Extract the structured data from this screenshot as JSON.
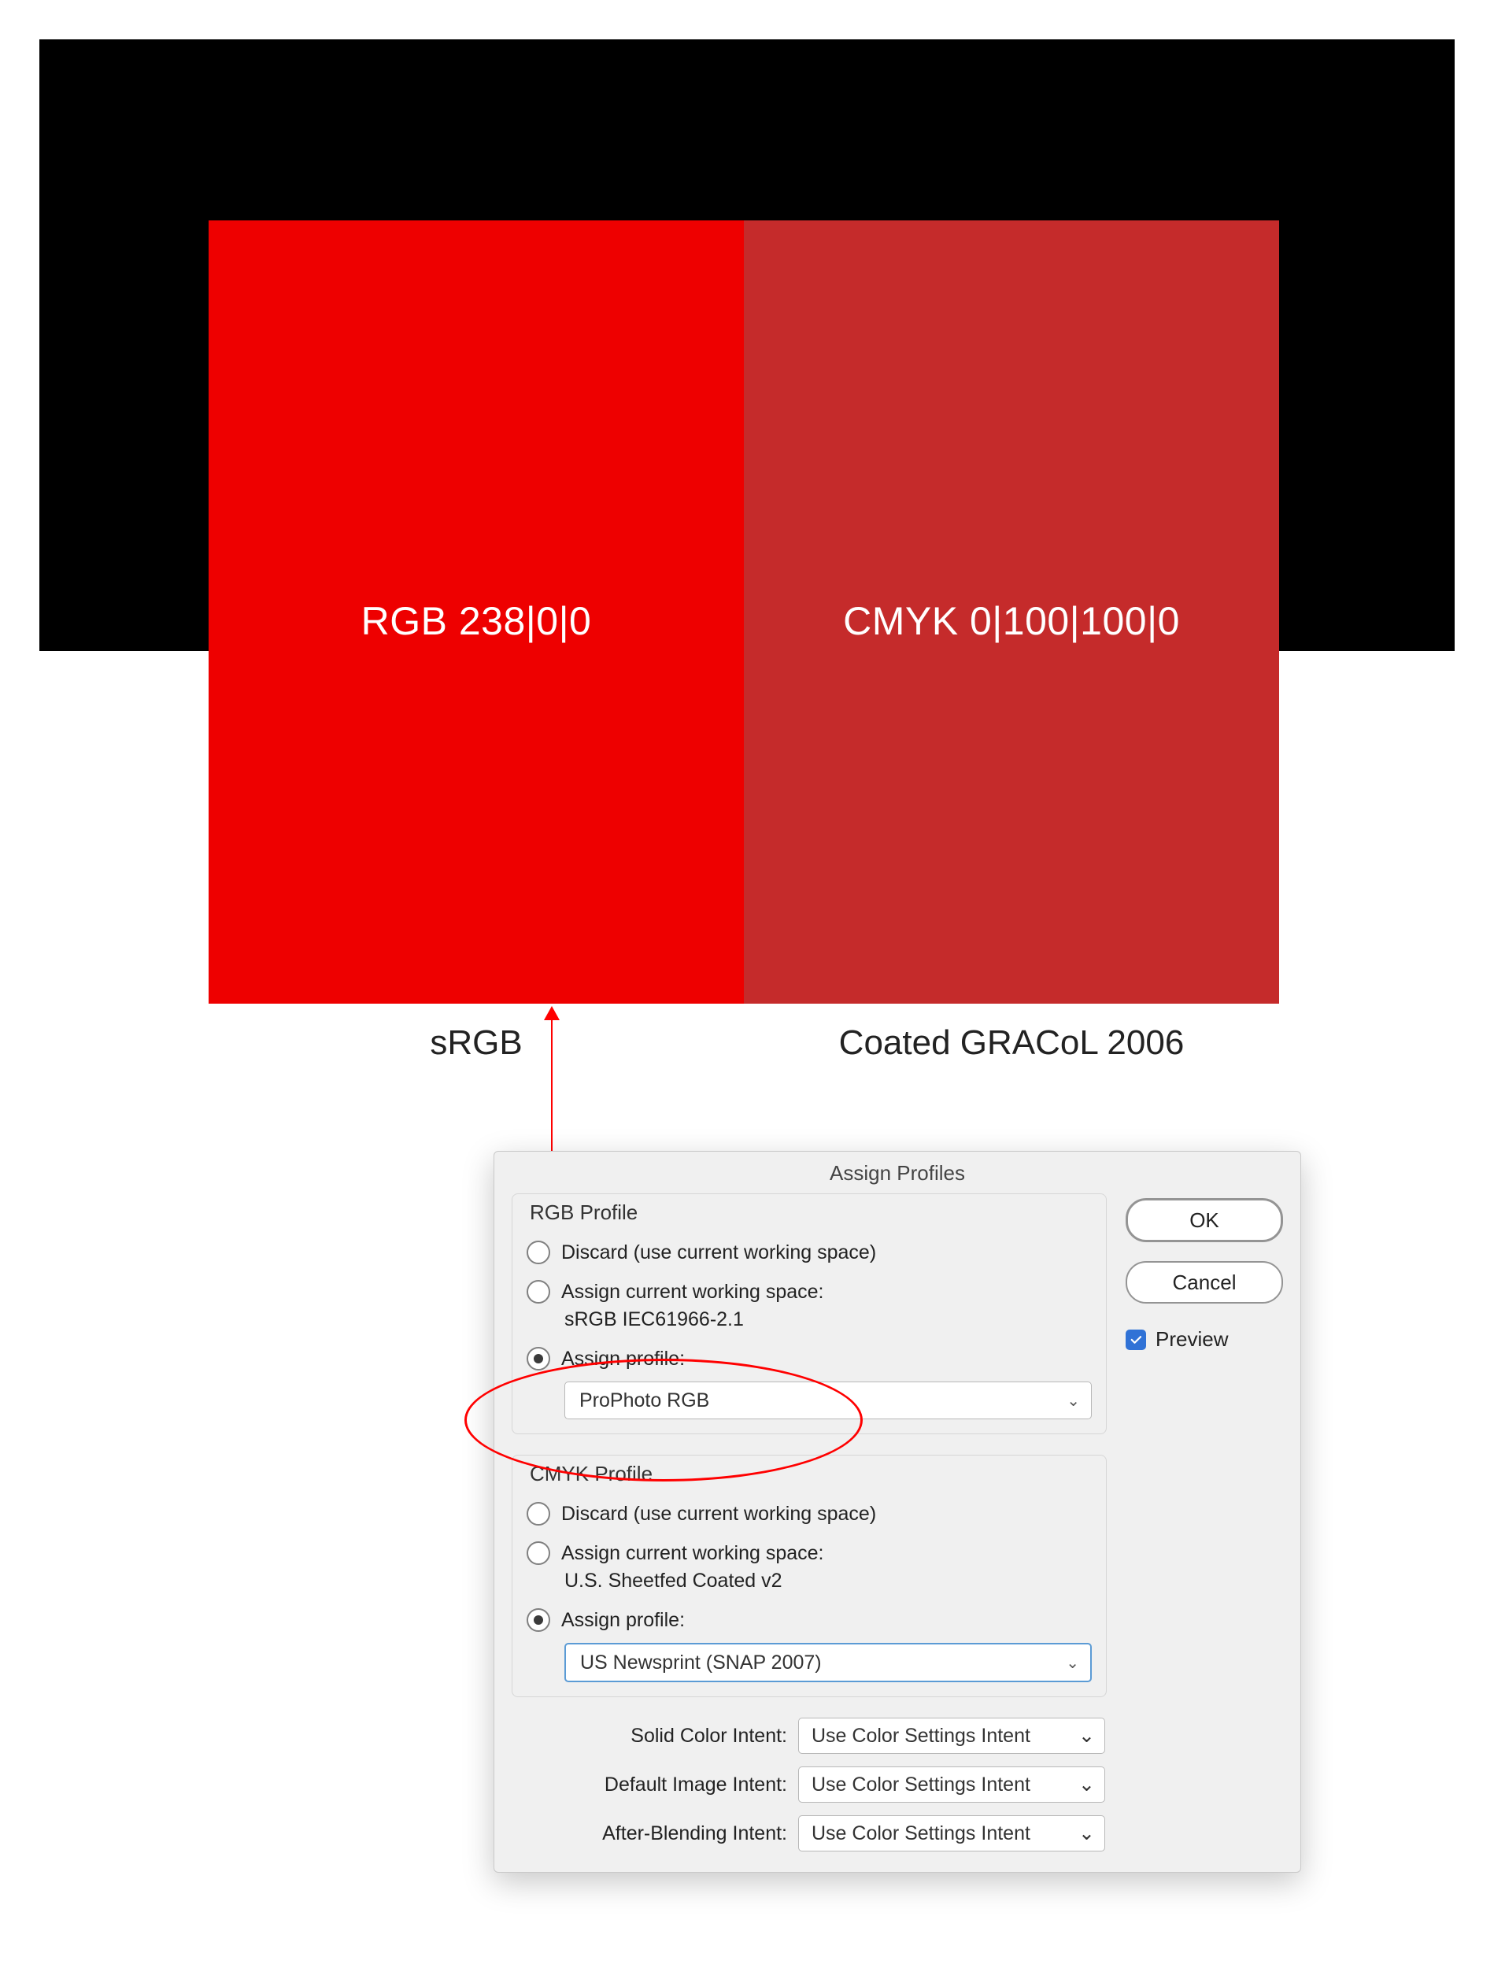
{
  "swatches": {
    "rgb_label": "RGB 238|0|0",
    "cmyk_label": "CMYK 0|100|100|0",
    "rgb_color": "#ee0000",
    "cmyk_color": "#c52b2b"
  },
  "captions": {
    "left": "sRGB",
    "right": "Coated GRACoL 2006"
  },
  "dialog": {
    "title": "Assign Profiles",
    "rgb": {
      "section_title": "RGB Profile",
      "discard": "Discard (use current working space)",
      "assign_current": "Assign current working space:",
      "current_value": "sRGB IEC61966-2.1",
      "assign_profile": "Assign profile:",
      "profile_value": "ProPhoto RGB"
    },
    "cmyk": {
      "section_title": "CMYK Profile",
      "discard": "Discard (use current working space)",
      "assign_current": "Assign current working space:",
      "current_value": "U.S. Sheetfed Coated v2",
      "assign_profile": "Assign profile:",
      "profile_value": "US Newsprint (SNAP 2007)"
    },
    "intents": {
      "solid_label": "Solid Color Intent:",
      "image_label": "Default Image Intent:",
      "blend_label": "After-Blending Intent:",
      "value": "Use Color Settings Intent"
    },
    "buttons": {
      "ok": "OK",
      "cancel": "Cancel",
      "preview": "Preview"
    }
  }
}
